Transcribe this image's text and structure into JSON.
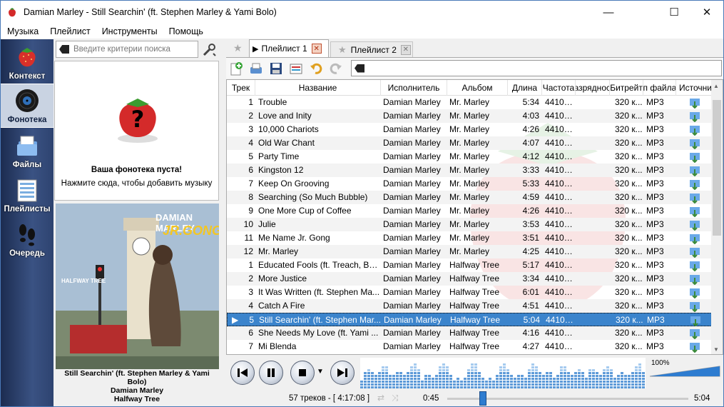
{
  "window": {
    "title": "Damian Marley - Still Searchin' (ft. Stephen Marley & Yami Bolo)",
    "minimize": "—",
    "maximize": "☐",
    "close": "✕"
  },
  "menu": [
    "Музыка",
    "Плейлист",
    "Инструменты",
    "Помощь"
  ],
  "sidebar": [
    {
      "label": "Контекст",
      "icon": "strawberry-icon",
      "active": false
    },
    {
      "label": "Фонотека",
      "icon": "vinyl-record-icon",
      "active": true
    },
    {
      "label": "Файлы",
      "icon": "files-icon",
      "active": false
    },
    {
      "label": "Плейлисты",
      "icon": "playlist-icon",
      "active": false
    },
    {
      "label": "Очередь",
      "icon": "footprints-icon",
      "active": false
    }
  ],
  "library": {
    "search_placeholder": "Введите критерии поиска",
    "empty_title": "Ваша фонотека пуста!",
    "empty_hint": "Нажмите сюда, чтобы добавить музыку"
  },
  "now_playing": {
    "title": "Still Searchin' (ft. Stephen Marley & Yami Bolo)",
    "artist": "Damian Marley",
    "album": "Halfway Tree",
    "cover_artist": "DAMIAN MARLEY",
    "cover_alias": "JR.GONG",
    "cover_album": "HALFWAY TREE"
  },
  "tabs": [
    {
      "label": "Плейлист 1",
      "selected": true
    },
    {
      "label": "Плейлист 2",
      "selected": false
    }
  ],
  "columns": [
    "Трек",
    "Название",
    "Исполнитель",
    "Альбом",
    "Длина",
    "Частота",
    "Разрядность",
    "Битрейт",
    "Тип файла",
    "Источник"
  ],
  "tracks": [
    {
      "track": "1",
      "title": "Trouble",
      "artist": "Damian Marley",
      "album": "Mr. Marley",
      "length": "5:34",
      "rate": "44100...",
      "bitrate": "320 к...",
      "type": "MP3"
    },
    {
      "track": "2",
      "title": "Love and Inity",
      "artist": "Damian Marley",
      "album": "Mr. Marley",
      "length": "4:03",
      "rate": "44100...",
      "bitrate": "320 к...",
      "type": "MP3"
    },
    {
      "track": "3",
      "title": "10,000 Chariots",
      "artist": "Damian Marley",
      "album": "Mr. Marley",
      "length": "4:26",
      "rate": "44100...",
      "bitrate": "320 к...",
      "type": "MP3"
    },
    {
      "track": "4",
      "title": "Old War Chant",
      "artist": "Damian Marley",
      "album": "Mr. Marley",
      "length": "4:07",
      "rate": "44100...",
      "bitrate": "320 к...",
      "type": "MP3"
    },
    {
      "track": "5",
      "title": "Party Time",
      "artist": "Damian Marley",
      "album": "Mr. Marley",
      "length": "4:12",
      "rate": "44100...",
      "bitrate": "320 к...",
      "type": "MP3"
    },
    {
      "track": "6",
      "title": "Kingston 12",
      "artist": "Damian Marley",
      "album": "Mr. Marley",
      "length": "3:33",
      "rate": "44100...",
      "bitrate": "320 к...",
      "type": "MP3"
    },
    {
      "track": "7",
      "title": "Keep On Grooving",
      "artist": "Damian Marley",
      "album": "Mr. Marley",
      "length": "5:33",
      "rate": "44100...",
      "bitrate": "320 к...",
      "type": "MP3"
    },
    {
      "track": "8",
      "title": "Searching (So Much Bubble)",
      "artist": "Damian Marley",
      "album": "Mr. Marley",
      "length": "4:59",
      "rate": "44100...",
      "bitrate": "320 к...",
      "type": "MP3"
    },
    {
      "track": "9",
      "title": "One More Cup of Coffee",
      "artist": "Damian Marley",
      "album": "Mr. Marley",
      "length": "4:26",
      "rate": "44100...",
      "bitrate": "320 к...",
      "type": "MP3"
    },
    {
      "track": "10",
      "title": "Julie",
      "artist": "Damian Marley",
      "album": "Mr. Marley",
      "length": "3:53",
      "rate": "44100...",
      "bitrate": "320 к...",
      "type": "MP3"
    },
    {
      "track": "11",
      "title": "Me Name Jr. Gong",
      "artist": "Damian Marley",
      "album": "Mr. Marley",
      "length": "3:51",
      "rate": "44100...",
      "bitrate": "320 к...",
      "type": "MP3"
    },
    {
      "track": "12",
      "title": "Mr. Marley",
      "artist": "Damian Marley",
      "album": "Mr. Marley",
      "length": "4:25",
      "rate": "44100...",
      "bitrate": "320 к...",
      "type": "MP3"
    },
    {
      "track": "1",
      "title": "Educated Fools (ft. Treach, Bu...",
      "artist": "Damian Marley",
      "album": "Halfway Tree",
      "length": "5:17",
      "rate": "44100...",
      "bitrate": "320 к...",
      "type": "MP3"
    },
    {
      "track": "2",
      "title": "More Justice",
      "artist": "Damian Marley",
      "album": "Halfway Tree",
      "length": "3:34",
      "rate": "44100...",
      "bitrate": "320 к...",
      "type": "MP3"
    },
    {
      "track": "3",
      "title": "It Was Written (ft. Stephen Ma...",
      "artist": "Damian Marley",
      "album": "Halfway Tree",
      "length": "6:01",
      "rate": "44100...",
      "bitrate": "320 к...",
      "type": "MP3"
    },
    {
      "track": "4",
      "title": "Catch A Fire",
      "artist": "Damian Marley",
      "album": "Halfway Tree",
      "length": "4:51",
      "rate": "44100...",
      "bitrate": "320 к...",
      "type": "MP3"
    },
    {
      "track": "5",
      "title": "Still Searchin' (ft. Stephen Mar...",
      "artist": "Damian Marley",
      "album": "Halfway Tree",
      "length": "5:04",
      "rate": "44100...",
      "bitrate": "320 к...",
      "type": "MP3",
      "current": true
    },
    {
      "track": "6",
      "title": "She Needs My Love (ft. Yami ...",
      "artist": "Damian Marley",
      "album": "Halfway Tree",
      "length": "4:16",
      "rate": "44100...",
      "bitrate": "320 к...",
      "type": "MP3"
    },
    {
      "track": "7",
      "title": "Mi Blenda",
      "artist": "Damian Marley",
      "album": "Halfway Tree",
      "length": "4:27",
      "rate": "44100...",
      "bitrate": "320 к...",
      "type": "MP3"
    }
  ],
  "player": {
    "volume": "100%",
    "volume_level": 1.0,
    "elapsed": "0:45",
    "total": "5:04",
    "progress_fraction": 0.148,
    "status": "57 треков - [ 4:17:08 ]"
  },
  "colors": {
    "accent": "#3b84cc",
    "sidebar": "#2e4370",
    "stop_red": "#c0392b"
  }
}
